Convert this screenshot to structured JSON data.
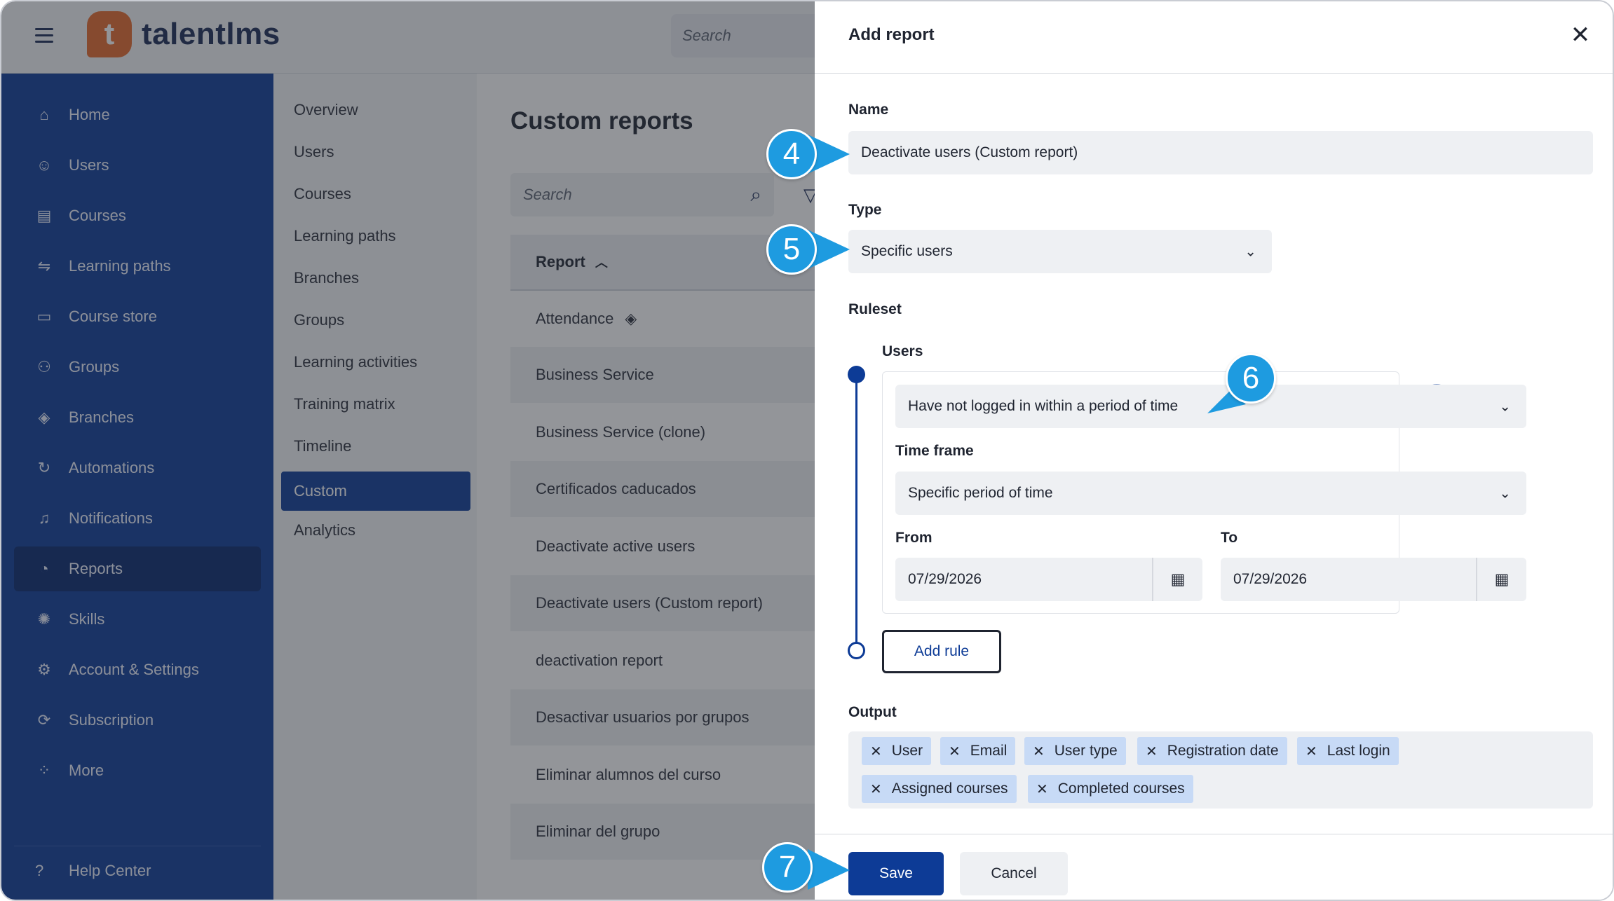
{
  "app": {
    "brand": "talentlms",
    "logo_letter": "t",
    "top_search_placeholder": "Search"
  },
  "sidebar": {
    "items": [
      {
        "label": "Home",
        "icon": "home-icon",
        "glyph": "⌂"
      },
      {
        "label": "Users",
        "icon": "user-icon",
        "glyph": "☺"
      },
      {
        "label": "Courses",
        "icon": "book-icon",
        "glyph": "▤"
      },
      {
        "label": "Learning paths",
        "icon": "path-icon",
        "glyph": "⇋"
      },
      {
        "label": "Course store",
        "icon": "store-icon",
        "glyph": "▭"
      },
      {
        "label": "Groups",
        "icon": "groups-icon",
        "glyph": "⚇"
      },
      {
        "label": "Branches",
        "icon": "layers-icon",
        "glyph": "◈"
      },
      {
        "label": "Automations",
        "icon": "automation-icon",
        "glyph": "↻"
      },
      {
        "label": "Notifications",
        "icon": "bell-icon",
        "glyph": "♫"
      },
      {
        "label": "Reports",
        "icon": "pie-chart-icon",
        "glyph": "◔",
        "active": true
      },
      {
        "label": "Skills",
        "icon": "skills-icon",
        "glyph": "✺"
      },
      {
        "label": "Account & Settings",
        "icon": "gear-icon",
        "glyph": "⚙"
      },
      {
        "label": "Subscription",
        "icon": "subscription-icon",
        "glyph": "⟳"
      },
      {
        "label": "More",
        "icon": "grid-icon",
        "glyph": "⁘"
      }
    ],
    "help_label": "Help Center"
  },
  "submenu": {
    "items": [
      "Overview",
      "Users",
      "Courses",
      "Learning paths",
      "Branches",
      "Groups",
      "Learning activities",
      "Training matrix",
      "Timeline",
      "Custom",
      "Analytics"
    ],
    "active_index": 9
  },
  "content": {
    "title": "Custom reports",
    "search_placeholder": "Search",
    "column_header": "Report",
    "rows": [
      "Attendance",
      "Business Service",
      "Business Service (clone)",
      "Certificados caducados",
      "Deactivate active users",
      "Deactivate users (Custom report)",
      "deactivation report",
      "Desactivar usuarios por grupos",
      "Eliminar alumnos del curso",
      "Eliminar del grupo"
    ]
  },
  "modal": {
    "title": "Add report",
    "name_label": "Name",
    "name_value": "Deactivate users (Custom report)",
    "type_label": "Type",
    "type_value": "Specific users",
    "ruleset_label": "Ruleset",
    "users_label": "Users",
    "rule_condition": "Have not logged in within a period of time",
    "time_frame_label": "Time frame",
    "time_frame_value": "Specific period of time",
    "from_label": "From",
    "from_value": "07/29/2026",
    "to_label": "To",
    "to_value": "07/29/2026",
    "add_rule_label": "Add rule",
    "output_label": "Output",
    "output_chips": [
      "User",
      "Email",
      "User type",
      "Registration date",
      "Last login",
      "Assigned courses",
      "Completed courses"
    ],
    "save_label": "Save",
    "cancel_label": "Cancel"
  },
  "callouts": [
    "4",
    "5",
    "6",
    "7"
  ],
  "colors": {
    "brand_blue": "#0d3b96",
    "callout_blue": "#1e9be0",
    "logo_orange": "#e5692a",
    "chip_blue": "#c7daf6"
  }
}
